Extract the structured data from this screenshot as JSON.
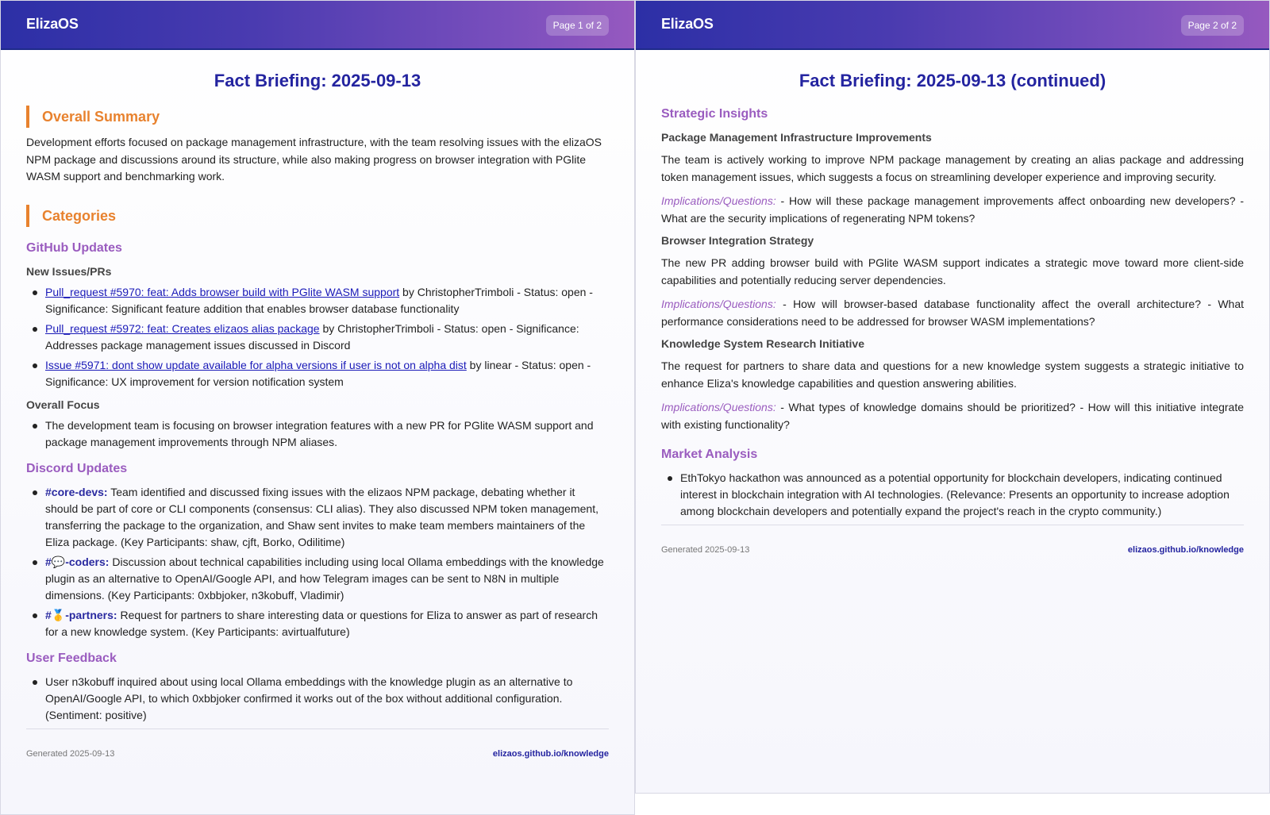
{
  "brand": "ElizaOS",
  "pages": [
    {
      "badge": "Page 1 of 2",
      "title": "Fact Briefing: 2025-09-13",
      "overall_summary": {
        "heading": "Overall Summary",
        "text": "Development efforts focused on package management infrastructure, with the team resolving issues with the elizaOS NPM package and discussions around its structure, while also making progress on browser integration with PGlite WASM support and benchmarking work."
      },
      "categories_heading": "Categories",
      "github": {
        "heading": "GitHub Updates",
        "new_issues_heading": "New Issues/PRs",
        "items": [
          {
            "link": "Pull_request #5970: feat: Adds browser build with PGlite WASM support",
            "text": " by ChristopherTrimboli - Status: open - Significance: Significant feature addition that enables browser database functionality"
          },
          {
            "link": "Pull_request #5972: feat: Creates elizaos alias package",
            "text": " by ChristopherTrimboli - Status: open - Significance: Addresses package management issues discussed in Discord"
          },
          {
            "link": "Issue #5971: dont show update available for alpha versions if user is not on alpha dist",
            "text": " by linear - Status: open - Significance: UX improvement for version notification system"
          }
        ],
        "focus_heading": "Overall Focus",
        "focus_items": [
          "The development team is focusing on browser integration features with a new PR for PGlite WASM support and package management improvements through NPM aliases."
        ]
      },
      "discord": {
        "heading": "Discord Updates",
        "items": [
          {
            "channel": "#core-devs:",
            "text": " Team identified and discussed fixing issues with the elizaos NPM package, debating whether it should be part of core or CLI components (consensus: CLI alias). They also discussed NPM token management, transferring the package to the organization, and Shaw sent invites to make team members maintainers of the Eliza package. (Key Participants: shaw, cjft, Borko, Odilitime)"
          },
          {
            "channel": "#💬-coders:",
            "text": " Discussion about technical capabilities including using local Ollama embeddings with the knowledge plugin as an alternative to OpenAI/Google API, and how Telegram images can be sent to N8N in multiple dimensions. (Key Participants: 0xbbjoker, n3kobuff, Vladimir)"
          },
          {
            "channel": "#🥇-partners:",
            "text": " Request for partners to share interesting data or questions for Eliza to answer as part of research for a new knowledge system. (Key Participants: avirtualfuture)"
          }
        ]
      },
      "user_feedback": {
        "heading": "User Feedback",
        "items": [
          "User n3kobuff inquired about using local Ollama embeddings with the knowledge plugin as an alternative to OpenAI/Google API, to which 0xbbjoker confirmed it works out of the box without additional configuration. (Sentiment: positive)"
        ]
      },
      "footer": {
        "generated": "Generated 2025-09-13",
        "site": "elizaos.github.io/knowledge"
      }
    },
    {
      "badge": "Page 2 of 2",
      "title": "Fact Briefing: 2025-09-13 (continued)",
      "strategic": {
        "heading": "Strategic Insights",
        "sections": [
          {
            "heading": "Package Management Infrastructure Improvements",
            "text": "The team is actively working to improve NPM package management by creating an alias package and addressing token management issues, which suggests a focus on streamlining developer experience and improving security.",
            "impl_label": "Implications/Questions:",
            "impl_text": " - How will these package management improvements affect onboarding new developers? - What are the security implications of regenerating NPM tokens?"
          },
          {
            "heading": "Browser Integration Strategy",
            "text": "The new PR adding browser build with PGlite WASM support indicates a strategic move toward more client-side capabilities and potentially reducing server dependencies.",
            "impl_label": "Implications/Questions:",
            "impl_text": " - How will browser-based database functionality affect the overall architecture? - What performance considerations need to be addressed for browser WASM implementations?"
          },
          {
            "heading": "Knowledge System Research Initiative",
            "text": "The request for partners to share data and questions for a new knowledge system suggests a strategic initiative to enhance Eliza's knowledge capabilities and question answering abilities.",
            "impl_label": "Implications/Questions:",
            "impl_text": " - What types of knowledge domains should be prioritized? - How will this initiative integrate with existing functionality?"
          }
        ]
      },
      "market": {
        "heading": "Market Analysis",
        "items": [
          "EthTokyo hackathon was announced as a potential opportunity for blockchain developers, indicating continued interest in blockchain integration with AI technologies. (Relevance: Presents an opportunity to increase adoption among blockchain developers and potentially expand the project's reach in the crypto community.)"
        ]
      },
      "footer": {
        "generated": "Generated 2025-09-13",
        "site": "elizaos.github.io/knowledge"
      }
    }
  ]
}
